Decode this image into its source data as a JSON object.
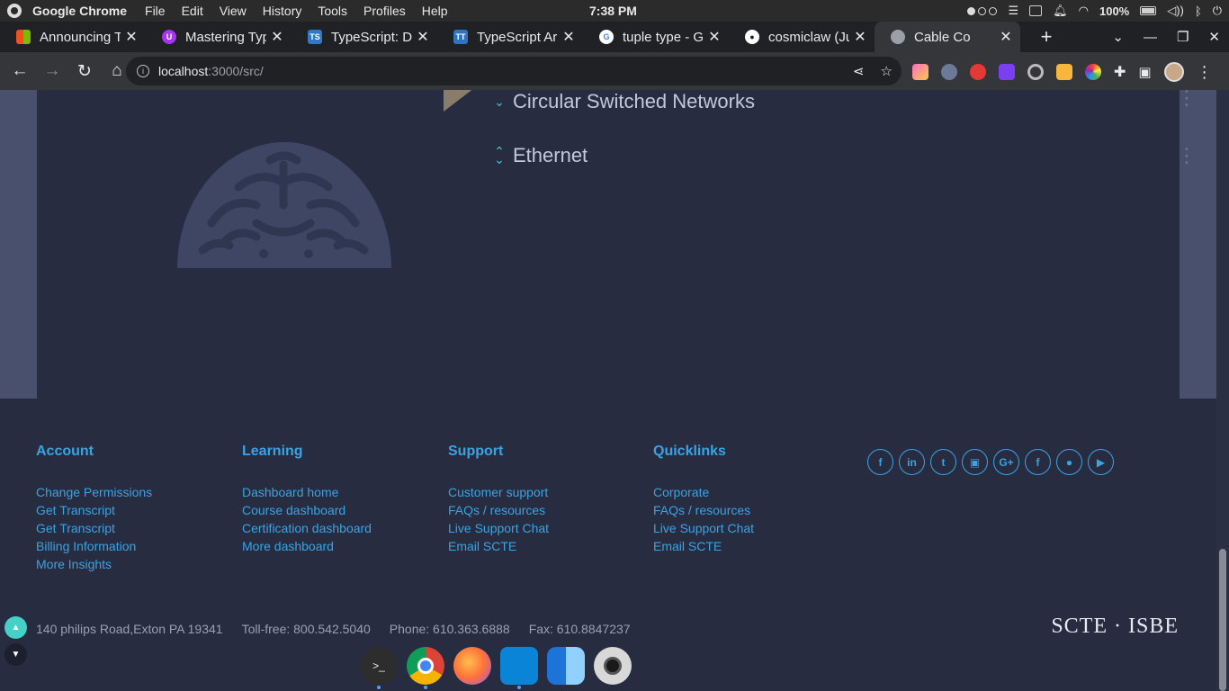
{
  "menubar": {
    "app_name": "Google Chrome",
    "items": [
      "File",
      "Edit",
      "View",
      "History",
      "Tools",
      "Profiles",
      "Help"
    ],
    "time": "7:38 PM",
    "battery": "100%"
  },
  "tabs": [
    {
      "title": "Announcing Ty",
      "favicon": "microsoft-icon",
      "color": "#f25022"
    },
    {
      "title": "Mastering Type",
      "favicon": "udemy-icon",
      "color": "#a435f0"
    },
    {
      "title": "TypeScript: Do",
      "favicon": "typescript-icon",
      "color": "#3178c6"
    },
    {
      "title": "TypeScript Arr",
      "favicon": "typescript-tt-icon",
      "color": "#2f74c0"
    },
    {
      "title": "tuple type - Go",
      "favicon": "google-icon",
      "color": "#ffffff"
    },
    {
      "title": "cosmiclaw (Ju",
      "favicon": "github-icon",
      "color": "#ffffff"
    },
    {
      "title": "Cable Co",
      "favicon": "globe-icon",
      "color": "#9aa0a6",
      "active": true
    }
  ],
  "toolbar": {
    "url_host": "localhost",
    "url_rest": ":3000/src/"
  },
  "accordion": [
    {
      "label": "Circular Switched Networks",
      "expanded": false
    },
    {
      "label": "Ethernet",
      "expanded": true
    }
  ],
  "footer": {
    "columns": [
      {
        "heading": "Account",
        "links": [
          "Change Permissions",
          "Get Transcript",
          "Get Transcript",
          "Billing Information",
          "More Insights"
        ]
      },
      {
        "heading": "Learning",
        "links": [
          "Dashboard home",
          "Course dashboard",
          "Certification dashboard",
          "More dashboard"
        ]
      },
      {
        "heading": "Support",
        "links": [
          "Customer support",
          "FAQs / resources",
          "Live Support Chat",
          "Email SCTE"
        ]
      },
      {
        "heading": "Quicklinks",
        "links": [
          "Corporate",
          "FAQs / resources",
          "Live Support Chat",
          "Email SCTE"
        ]
      }
    ],
    "socials": [
      {
        "name": "facebook-icon",
        "glyph": "f"
      },
      {
        "name": "linkedin-icon",
        "glyph": "in"
      },
      {
        "name": "twitter-icon",
        "glyph": "t"
      },
      {
        "name": "youtube-icon",
        "glyph": "▣"
      },
      {
        "name": "google-plus-icon",
        "glyph": "G+"
      },
      {
        "name": "facebook-icon",
        "glyph": "f"
      },
      {
        "name": "apple-icon",
        "glyph": "●"
      },
      {
        "name": "google-play-icon",
        "glyph": "▶"
      }
    ],
    "address": "140 philips Road,Exton PA 19341",
    "tollfree": "Toll-free: 800.542.5040",
    "phone": "Phone: 610.363.6888",
    "fax": "Fax: 610.8847237",
    "brand": "SCTE · ISBE"
  },
  "dock": [
    {
      "name": "terminal-icon",
      "color": "#2d2d2d"
    },
    {
      "name": "chrome-icon",
      "color": "#db4437"
    },
    {
      "name": "firefox-icon",
      "color": "#ff7139"
    },
    {
      "name": "vscode-icon",
      "color": "#0a84d6"
    },
    {
      "name": "finder-icon",
      "color": "#3ea5f5"
    },
    {
      "name": "camera-icon",
      "color": "#d8d8d8"
    }
  ]
}
